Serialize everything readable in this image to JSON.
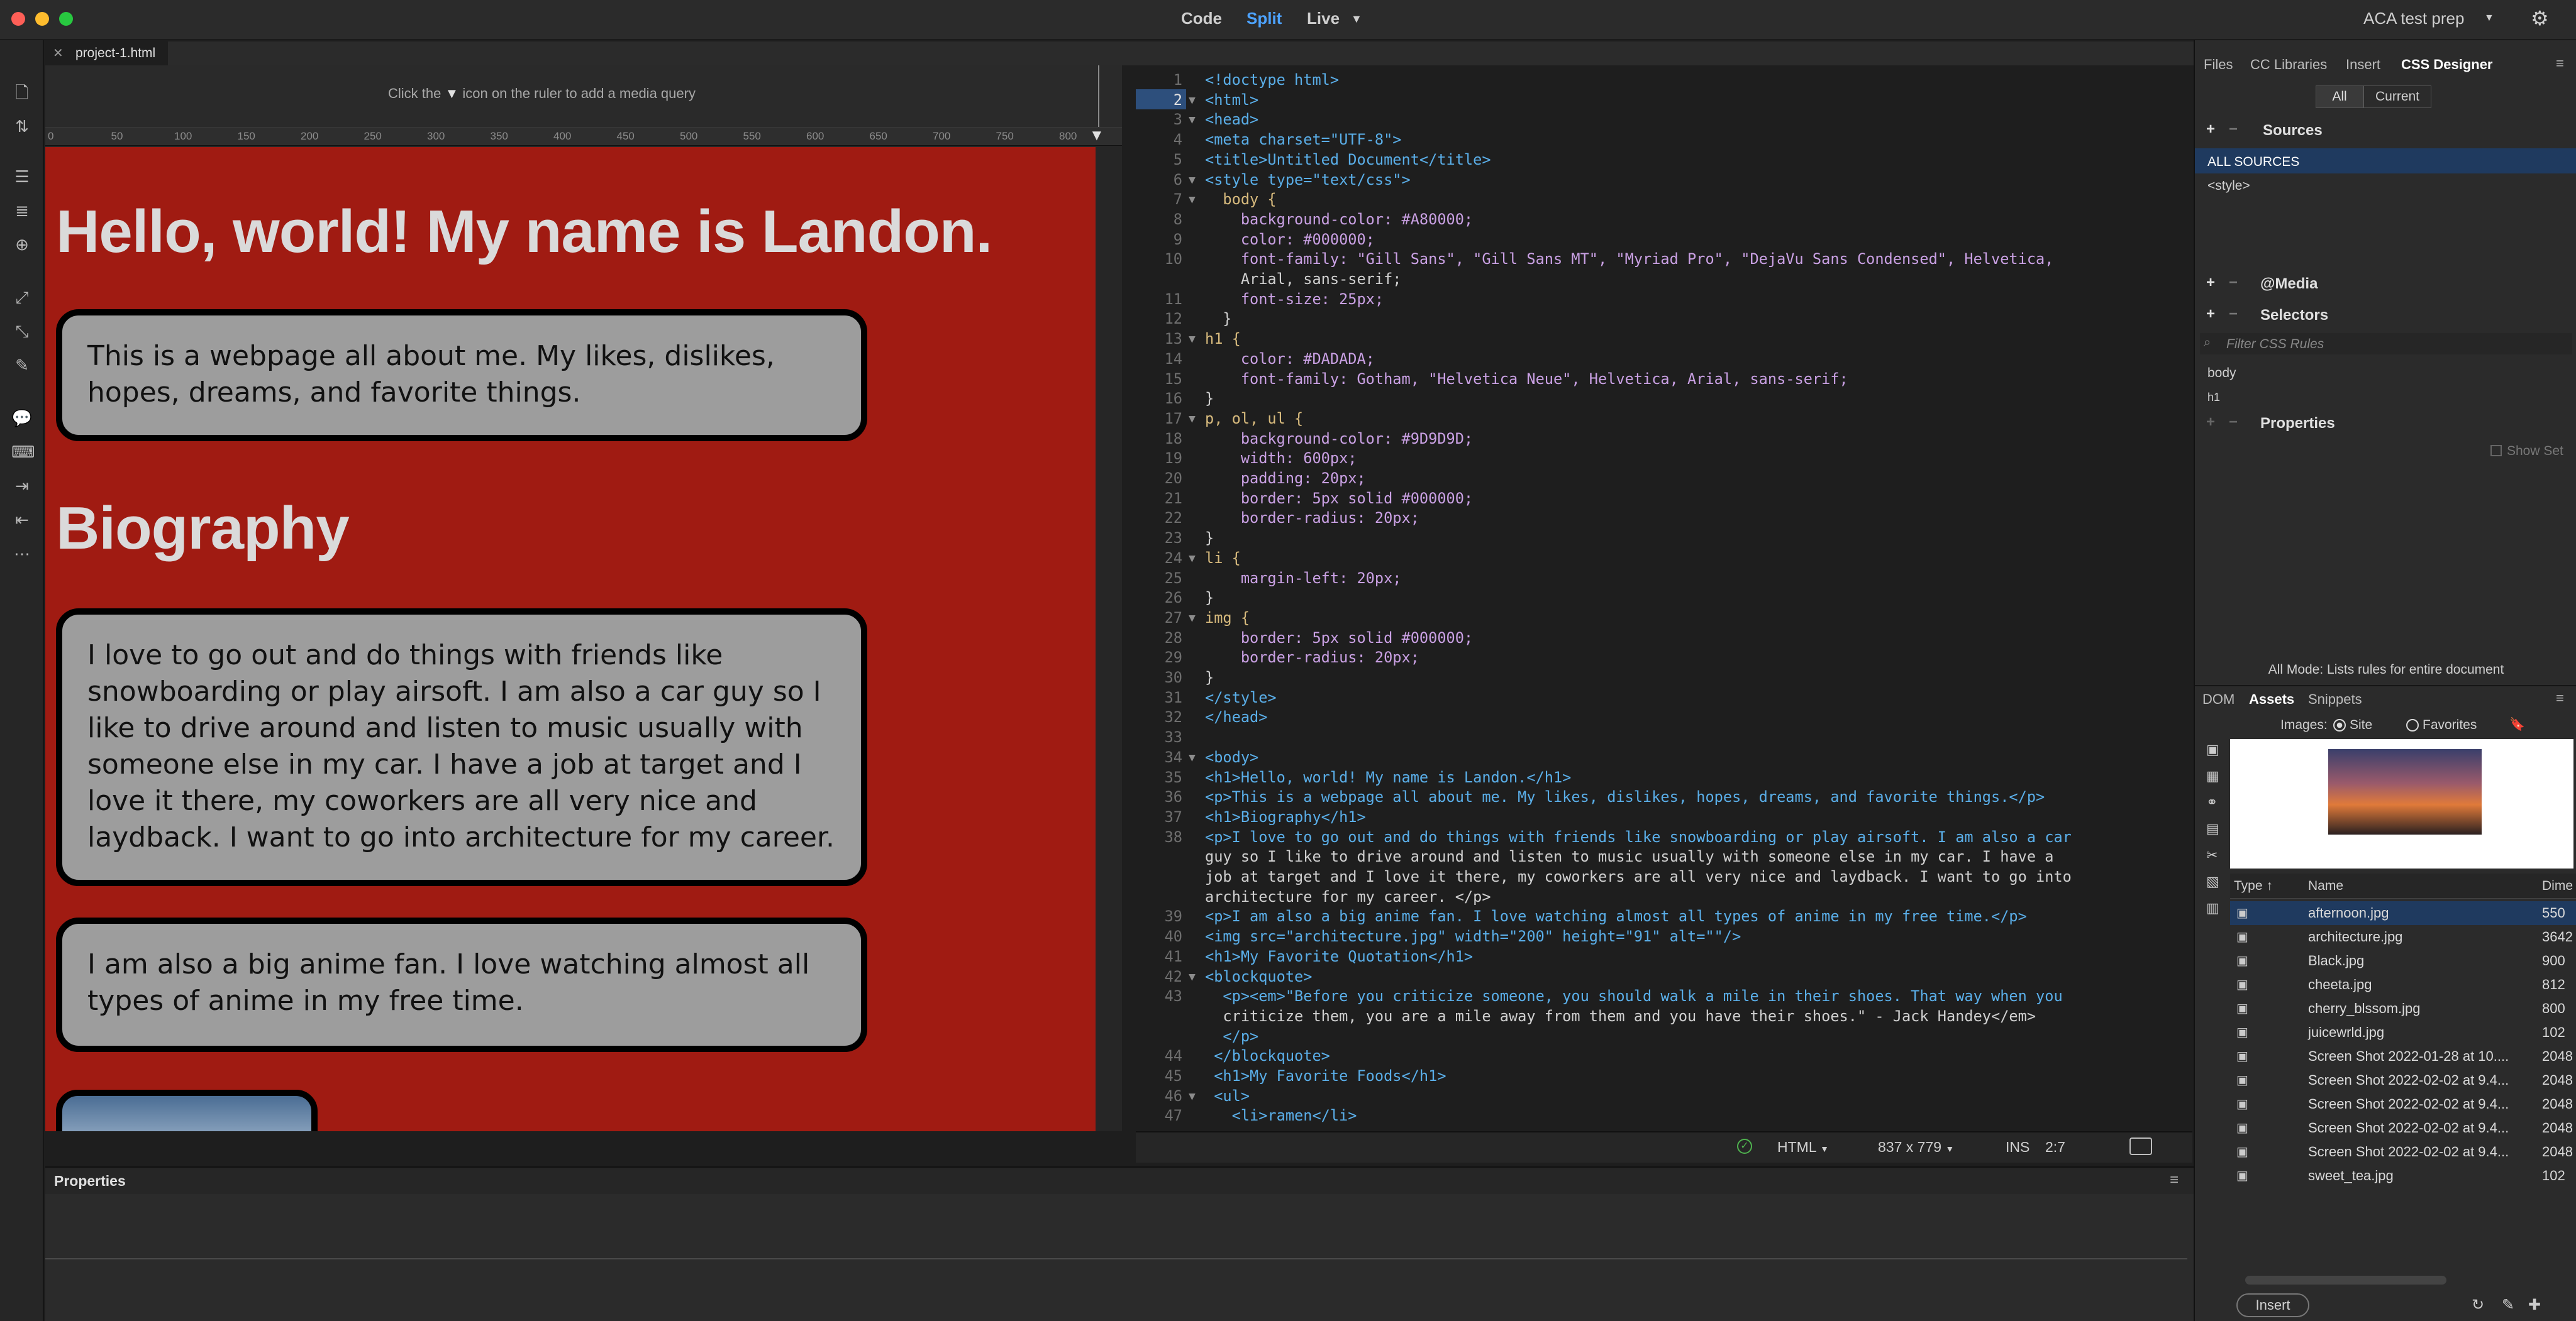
{
  "titlebar": {
    "modes": [
      "Code",
      "Split",
      "Live"
    ],
    "active_mode": "Split",
    "workspace": "ACA test prep"
  },
  "document_tab": "project-1.html",
  "design_view": {
    "media_query_hint_pre": "Click the",
    "media_query_hint_post": "icon on the ruler to add a media query",
    "ruler_ticks": [
      "0",
      "50",
      "100",
      "150",
      "200",
      "250",
      "300",
      "350",
      "400",
      "450",
      "500",
      "550",
      "600",
      "650",
      "700",
      "750",
      "800"
    ],
    "heading_1": "Hello, world! My name is Landon.",
    "paragraph_1": "This is a webpage all about me. My likes, dislikes, hopes, dreams, and favorite things.",
    "heading_2": "Biography",
    "paragraph_2": "I love to go out and do things with friends like snowboarding or play airsoft. I am also a car guy so I like to drive around and listen to music usually with someone else in my car. I have a job at target and I love it there, my coworkers are all very nice and laydback. I want to go into architecture for my career.",
    "paragraph_3": "I am also a big anime fan. I love watching almost all types of anime in my free time."
  },
  "code_lines": [
    {
      "n": "1",
      "f": "",
      "t": "<!doctype html>"
    },
    {
      "n": "2",
      "f": "▼",
      "t": "<html>"
    },
    {
      "n": "3",
      "f": "▼",
      "t": "<head>"
    },
    {
      "n": "4",
      "f": "",
      "t": "<meta charset=\"UTF-8\">"
    },
    {
      "n": "5",
      "f": "",
      "t": "<title>Untitled Document</title>"
    },
    {
      "n": "6",
      "f": "▼",
      "t": "<style type=\"text/css\">"
    },
    {
      "n": "7",
      "f": "▼",
      "t": "  body {"
    },
    {
      "n": "8",
      "f": "",
      "t": "    background-color: #A80000;"
    },
    {
      "n": "9",
      "f": "",
      "t": "    color: #000000;"
    },
    {
      "n": "10",
      "f": "",
      "t": "    font-family: \"Gill Sans\", \"Gill Sans MT\", \"Myriad Pro\", \"DejaVu Sans Condensed\", Helvetica,"
    },
    {
      "n": "",
      "f": "",
      "t": "    Arial, sans-serif;"
    },
    {
      "n": "11",
      "f": "",
      "t": "    font-size: 25px;"
    },
    {
      "n": "12",
      "f": "",
      "t": "  }"
    },
    {
      "n": "13",
      "f": "▼",
      "t": "h1 {"
    },
    {
      "n": "14",
      "f": "",
      "t": "    color: #DADADA;"
    },
    {
      "n": "15",
      "f": "",
      "t": "    font-family: Gotham, \"Helvetica Neue\", Helvetica, Arial, sans-serif;"
    },
    {
      "n": "16",
      "f": "",
      "t": "}"
    },
    {
      "n": "17",
      "f": "▼",
      "t": "p, ol, ul {"
    },
    {
      "n": "18",
      "f": "",
      "t": "    background-color: #9D9D9D;"
    },
    {
      "n": "19",
      "f": "",
      "t": "    width: 600px;"
    },
    {
      "n": "20",
      "f": "",
      "t": "    padding: 20px;"
    },
    {
      "n": "21",
      "f": "",
      "t": "    border: 5px solid #000000;"
    },
    {
      "n": "22",
      "f": "",
      "t": "    border-radius: 20px;"
    },
    {
      "n": "23",
      "f": "",
      "t": "}"
    },
    {
      "n": "24",
      "f": "▼",
      "t": "li {"
    },
    {
      "n": "25",
      "f": "",
      "t": "    margin-left: 20px;"
    },
    {
      "n": "26",
      "f": "",
      "t": "}"
    },
    {
      "n": "27",
      "f": "▼",
      "t": "img {"
    },
    {
      "n": "28",
      "f": "",
      "t": "    border: 5px solid #000000;"
    },
    {
      "n": "29",
      "f": "",
      "t": "    border-radius: 20px;"
    },
    {
      "n": "30",
      "f": "",
      "t": "}"
    },
    {
      "n": "31",
      "f": "",
      "t": "</style>"
    },
    {
      "n": "32",
      "f": "",
      "t": "</head>"
    },
    {
      "n": "33",
      "f": "",
      "t": ""
    },
    {
      "n": "34",
      "f": "▼",
      "t": "<body>"
    },
    {
      "n": "35",
      "f": "",
      "t": "<h1>Hello, world! My name is Landon.</h1>"
    },
    {
      "n": "36",
      "f": "",
      "t": "<p>This is a webpage all about me. My likes, dislikes, hopes, dreams, and favorite things.</p>"
    },
    {
      "n": "37",
      "f": "",
      "t": "<h1>Biography</h1>"
    },
    {
      "n": "38",
      "f": "",
      "t": "<p>I love to go out and do things with friends like snowboarding or play airsoft. I am also a car"
    },
    {
      "n": "",
      "f": "",
      "t": "guy so I like to drive around and listen to music usually with someone else in my car. I have a"
    },
    {
      "n": "",
      "f": "",
      "t": "job at target and I love it there, my coworkers are all very nice and laydback. I want to go into"
    },
    {
      "n": "",
      "f": "",
      "t": "architecture for my career. </p>"
    },
    {
      "n": "39",
      "f": "",
      "t": "<p>I am also a big anime fan. I love watching almost all types of anime in my free time.</p>"
    },
    {
      "n": "40",
      "f": "",
      "t": "<img src=\"architecture.jpg\" width=\"200\" height=\"91\" alt=\"\"/>"
    },
    {
      "n": "41",
      "f": "",
      "t": "<h1>My Favorite Quotation</h1>"
    },
    {
      "n": "42",
      "f": "▼",
      "t": "<blockquote>"
    },
    {
      "n": "43",
      "f": "",
      "t": "  <p><em>\"Before you criticize someone, you should walk a mile in their shoes. That way when you"
    },
    {
      "n": "",
      "f": "",
      "t": "  criticize them, you are a mile away from them and you have their shoes.\" - Jack Handey</em>"
    },
    {
      "n": "",
      "f": "",
      "t": "  </p>"
    },
    {
      "n": "44",
      "f": "",
      "t": " </blockquote>"
    },
    {
      "n": "45",
      "f": "",
      "t": " <h1>My Favorite Foods</h1>"
    },
    {
      "n": "46",
      "f": "▼",
      "t": " <ul>"
    },
    {
      "n": "47",
      "f": "",
      "t": "   <li>ramen</li>"
    }
  ],
  "statusbar": {
    "doc_type": "HTML",
    "window_size": "837 x 779",
    "insert_mode": "INS",
    "cursor_pos": "2:7"
  },
  "properties_panel": {
    "title": "Properties"
  },
  "right_panel": {
    "tabs": [
      "Files",
      "CC Libraries",
      "Insert",
      "CSS Designer"
    ],
    "active_tab": "CSS Designer",
    "toggle": [
      "All",
      "Current"
    ],
    "sources_label": "Sources",
    "all_sources": "ALL SOURCES",
    "style_source": "<style>",
    "media_label": "@Media",
    "selectors_label": "Selectors",
    "filter_placeholder": "Filter CSS Rules",
    "selectors": [
      "body",
      "h1"
    ],
    "properties_label": "Properties",
    "show_set": "Show Set",
    "mode_hint": "All Mode: Lists rules for entire document",
    "bottom_tabs": [
      "DOM",
      "Assets",
      "Snippets"
    ],
    "active_bottom_tab": "Assets",
    "images_label": "Images:",
    "site_label": "Site",
    "favorites_label": "Favorites",
    "columns": [
      "Type ↑",
      "Name",
      "Dime"
    ],
    "assets": [
      {
        "name": "afternoon.jpg",
        "dim": "550"
      },
      {
        "name": "architecture.jpg",
        "dim": "3642"
      },
      {
        "name": "Black.jpg",
        "dim": "900"
      },
      {
        "name": "cheeta.jpg",
        "dim": "812"
      },
      {
        "name": "cherry_blssom.jpg",
        "dim": "800"
      },
      {
        "name": "juicewrld.jpg",
        "dim": "102"
      },
      {
        "name": "Screen Shot 2022-01-28 at 10....",
        "dim": "2048"
      },
      {
        "name": "Screen Shot 2022-02-02 at 9.4...",
        "dim": "2048"
      },
      {
        "name": "Screen Shot 2022-02-02 at 9.4...",
        "dim": "2048"
      },
      {
        "name": "Screen Shot 2022-02-02 at 9.4...",
        "dim": "2048"
      },
      {
        "name": "Screen Shot 2022-02-02 at 9.4...",
        "dim": "2048"
      },
      {
        "name": "sweet_tea.jpg",
        "dim": "102"
      }
    ],
    "insert_button": "Insert"
  },
  "colors": {
    "page_bg": "#A80000",
    "h1_color": "#DADADA",
    "box_bg": "#9D9D9D",
    "accent": "#4DA3FF"
  }
}
